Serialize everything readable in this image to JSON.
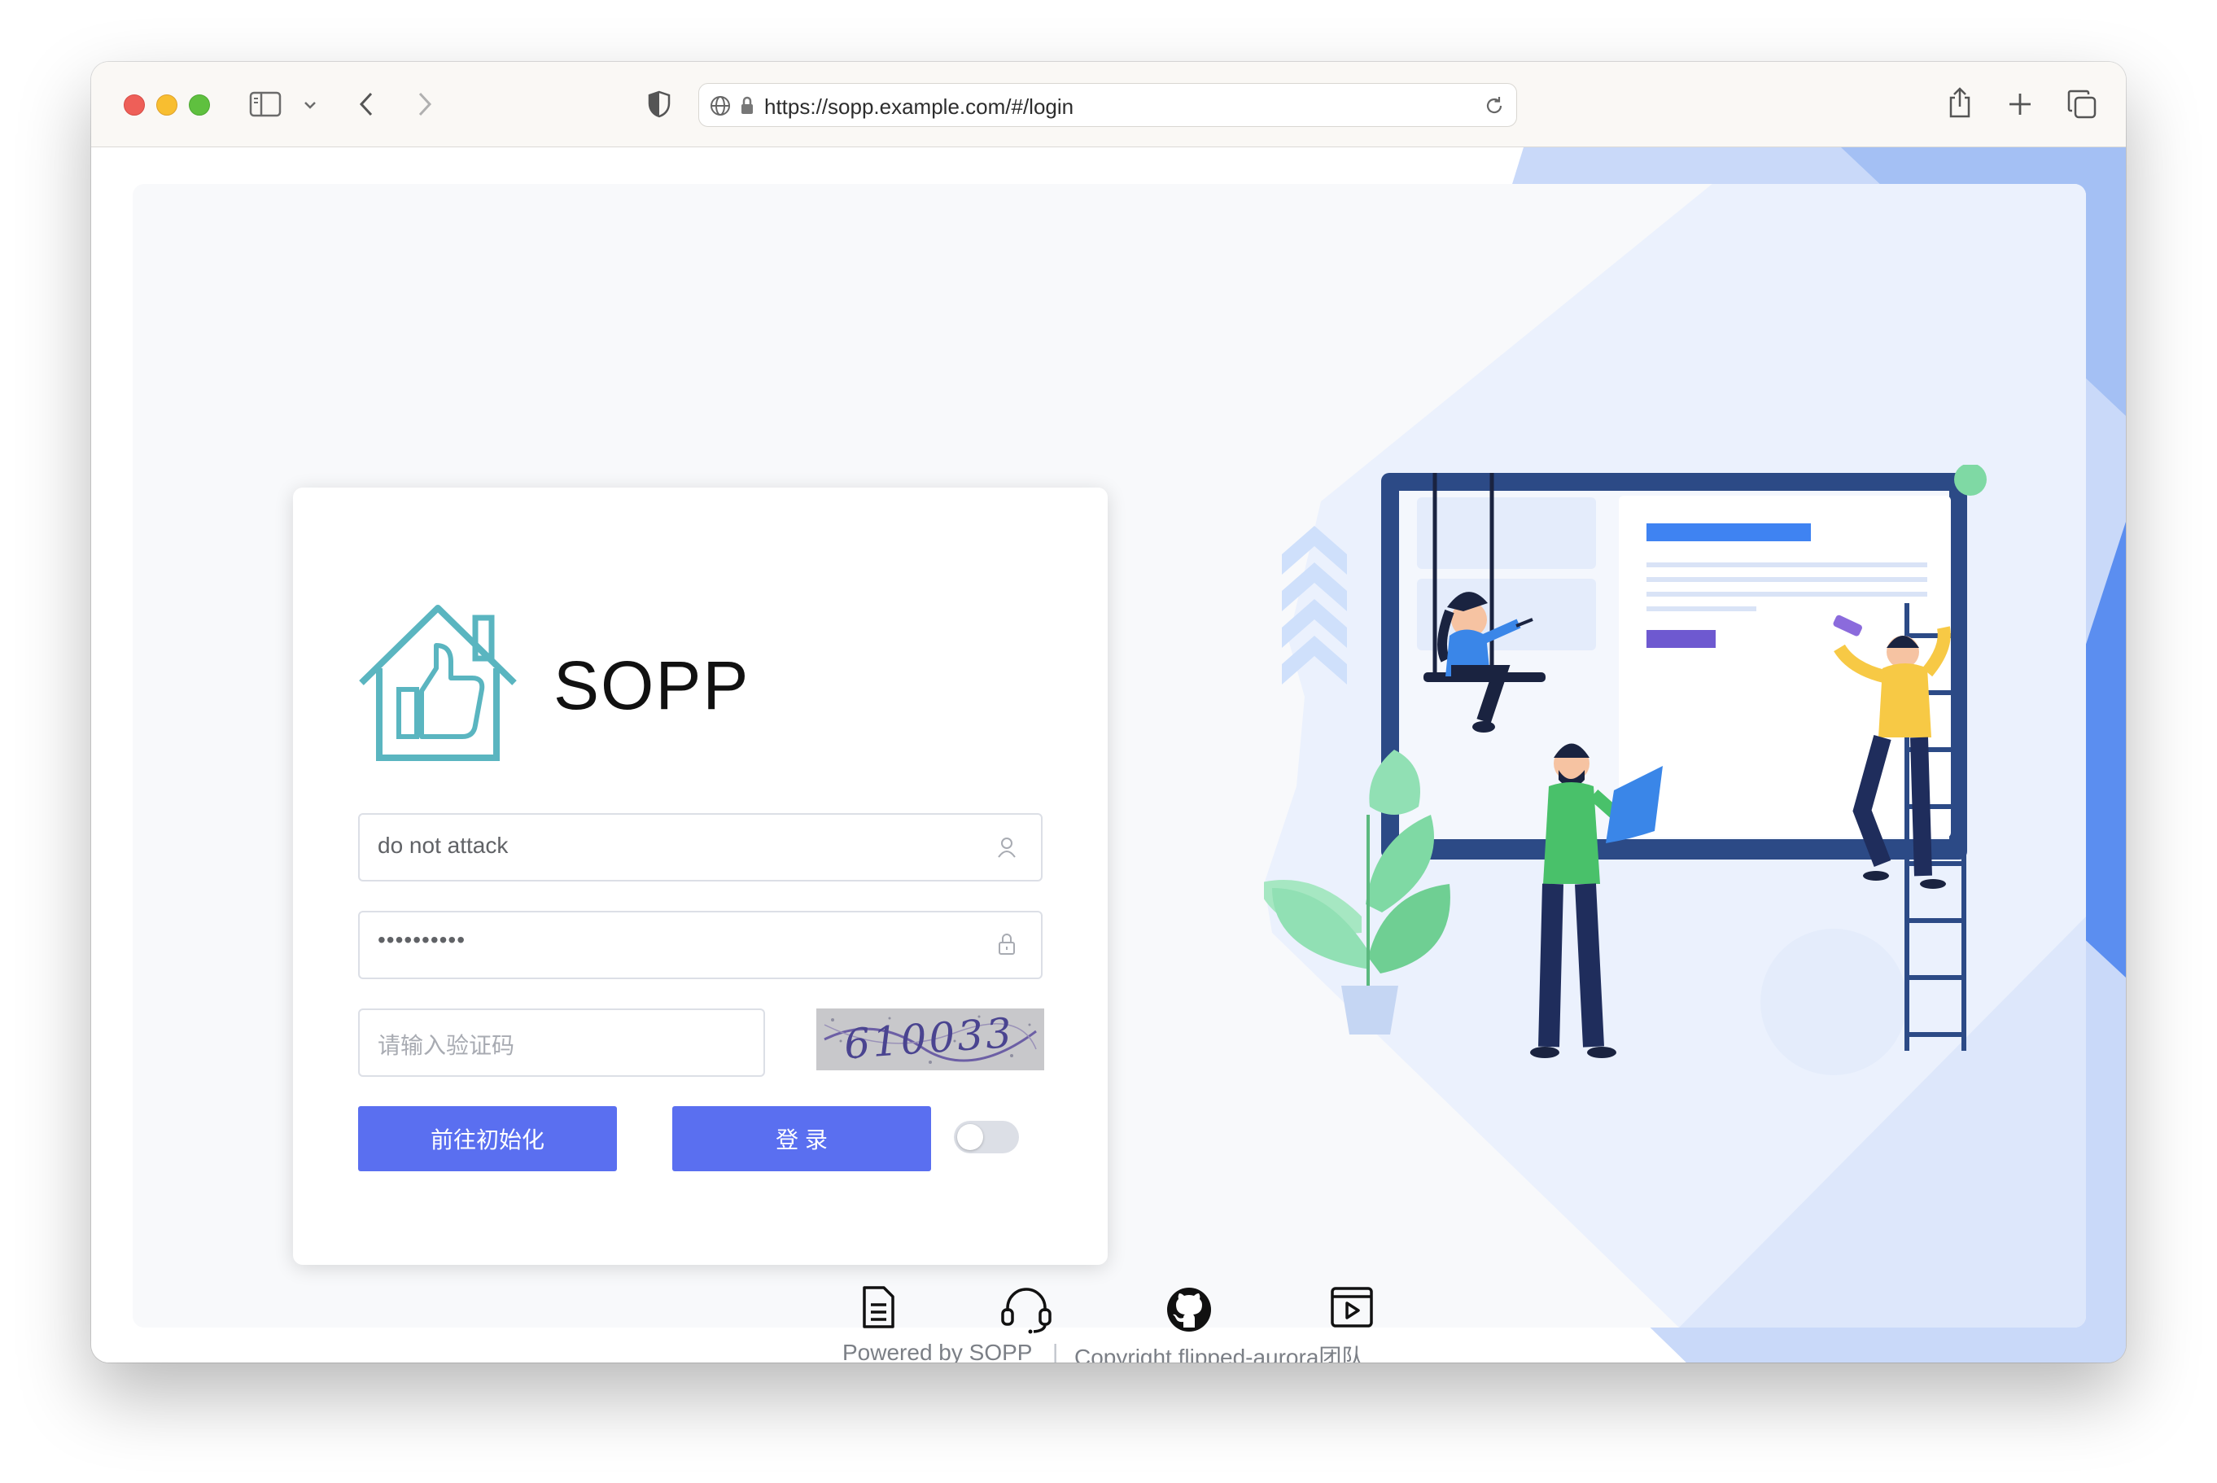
{
  "browser": {
    "url": "https://sopp.example.com/#/login"
  },
  "login": {
    "brand": "SOPP",
    "username_value": "do not attack",
    "password_value": "••••••••••",
    "captcha_placeholder": "请输入验证码",
    "captcha_code": "610033",
    "init_button": "前往初始化",
    "login_button": "登 录",
    "toggle_on": false
  },
  "footer": {
    "powered_by_prefix": "Powered by",
    "powered_by_name": "SOPP",
    "separator": "|",
    "copyright_prefix": "Copyright",
    "copyright_name": "flipped-aurora团队",
    "icons": [
      "document-icon",
      "headset-icon",
      "github-icon",
      "video-icon"
    ]
  },
  "colors": {
    "primary": "#5a6ff0",
    "logo": "#5ab5c0",
    "illustration_blue": "#2c4a86"
  }
}
